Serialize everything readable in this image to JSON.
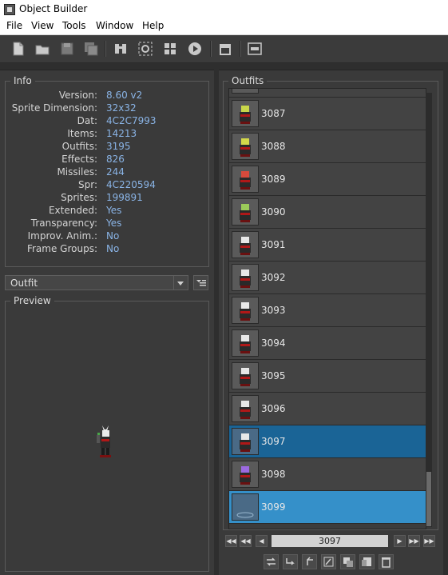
{
  "window": {
    "title": "Object Builder"
  },
  "menu": [
    "File",
    "View",
    "Tools",
    "Window",
    "Help"
  ],
  "toolbar_icons": [
    "new-file-icon",
    "open-folder-icon",
    "save-icon",
    "save-as-icon",
    "find-icon",
    "sprite-finder-icon",
    "object-viewer-icon",
    "animation-player-icon",
    "store-icon",
    "log-icon"
  ],
  "info": {
    "title": "Info",
    "rows": [
      {
        "label": "Version:",
        "value": "8.60 v2"
      },
      {
        "label": "Sprite Dimension:",
        "value": "32x32"
      },
      {
        "label": "Dat:",
        "value": "4C2C7993"
      },
      {
        "label": "Items:",
        "value": "14213"
      },
      {
        "label": "Outfits:",
        "value": "3195"
      },
      {
        "label": "Effects:",
        "value": "826"
      },
      {
        "label": "Missiles:",
        "value": "244"
      },
      {
        "label": "Spr:",
        "value": "4C220594"
      },
      {
        "label": "Sprites:",
        "value": "199891"
      },
      {
        "label": "Extended:",
        "value": "Yes"
      },
      {
        "label": "Transparency:",
        "value": "Yes"
      },
      {
        "label": "Improv. Anim.:",
        "value": "No"
      },
      {
        "label": "Frame Groups:",
        "value": "No"
      }
    ]
  },
  "category_select": {
    "value": "Outfit"
  },
  "preview": {
    "title": "Preview"
  },
  "outfits": {
    "title": "Outfits",
    "items": [
      {
        "id": "3087",
        "state": "normal",
        "color": "#c8d64a"
      },
      {
        "id": "3088",
        "state": "normal",
        "color": "#d3d84a"
      },
      {
        "id": "3089",
        "state": "normal",
        "color": "#d64a3c"
      },
      {
        "id": "3090",
        "state": "normal",
        "color": "#9bcb5a"
      },
      {
        "id": "3091",
        "state": "normal",
        "color": "#e8e8e8"
      },
      {
        "id": "3092",
        "state": "normal",
        "color": "#e8e8e8"
      },
      {
        "id": "3093",
        "state": "normal",
        "color": "#e8e8e8"
      },
      {
        "id": "3094",
        "state": "normal",
        "color": "#e8e8e8"
      },
      {
        "id": "3095",
        "state": "normal",
        "color": "#e8e8e8"
      },
      {
        "id": "3096",
        "state": "normal",
        "color": "#e8e8e8"
      },
      {
        "id": "3097",
        "state": "selected",
        "color": "#e8e8e8"
      },
      {
        "id": "3098",
        "state": "normal",
        "color": "#9c6ae0"
      },
      {
        "id": "3099",
        "state": "highlighted",
        "color": ""
      }
    ],
    "current": "3097"
  },
  "action_icons": [
    "replace-icon",
    "import-icon",
    "export-icon",
    "edit-icon",
    "duplicate-icon",
    "new-object-icon",
    "delete-icon"
  ]
}
